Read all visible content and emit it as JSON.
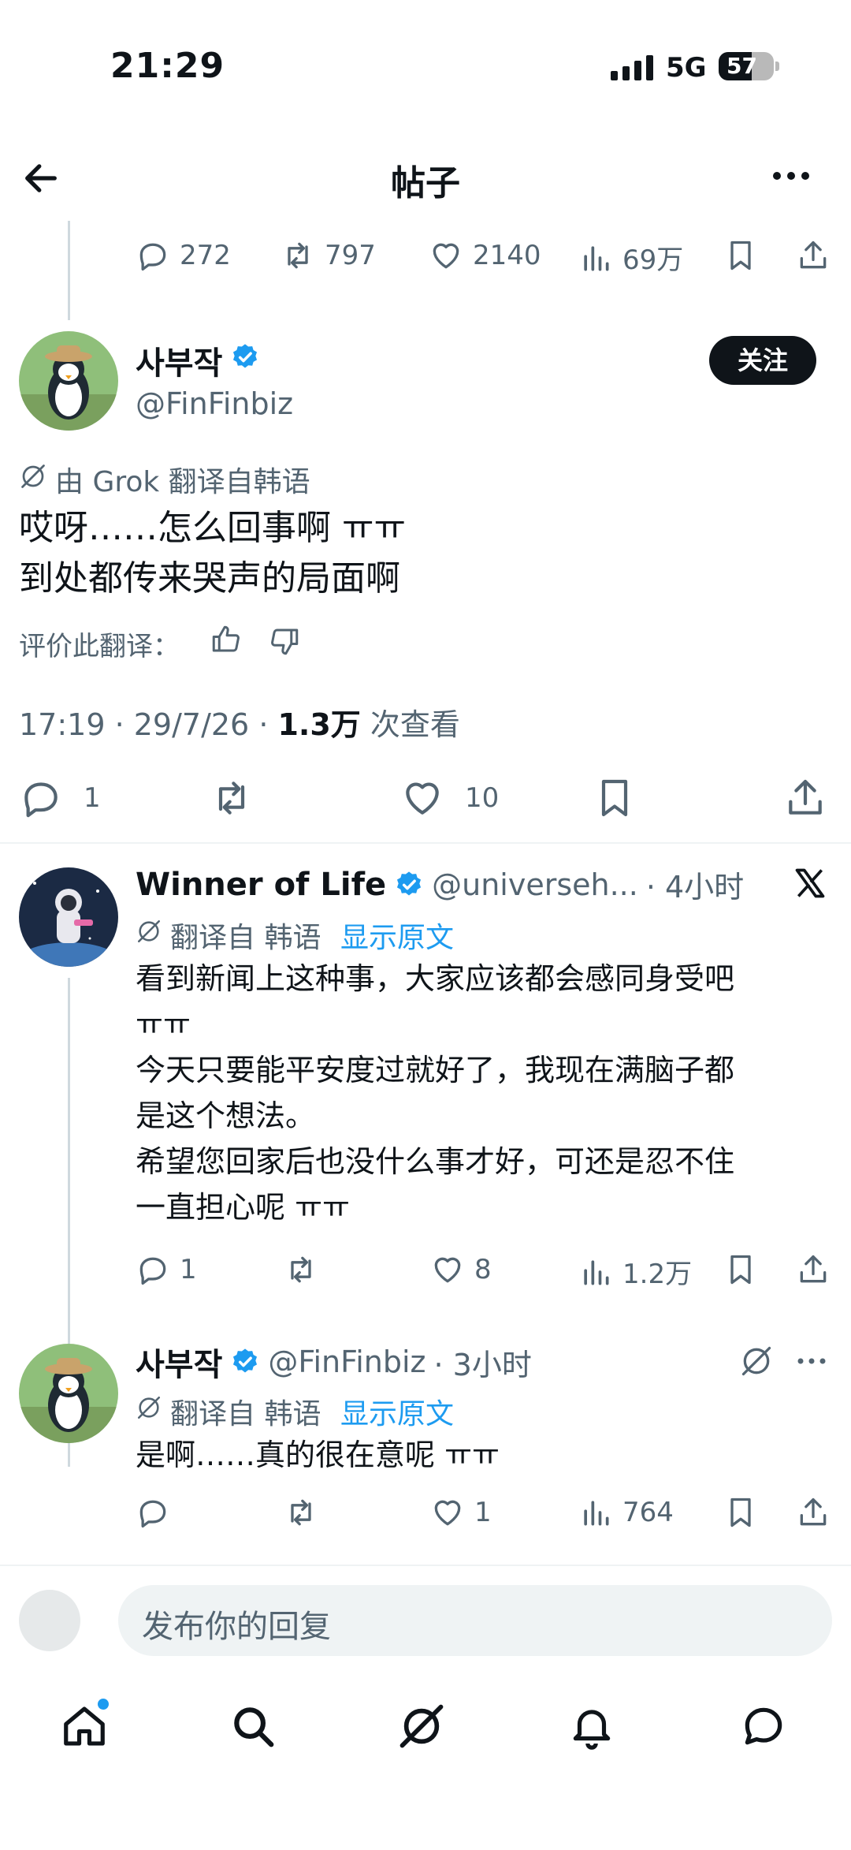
{
  "status_bar": {
    "time": "21:29",
    "network": "5G",
    "battery": "57"
  },
  "header": {
    "title": "帖子"
  },
  "top_actions": {
    "replies": "272",
    "reposts": "797",
    "likes": "2140",
    "views": "69万"
  },
  "main_post": {
    "author_name": "사부작",
    "handle": "@FinFinbiz",
    "follow_label": "关注",
    "translation_note": "由 Grok 翻译自韩语",
    "lines": [
      "哎呀……怎么回事啊 ㅠㅠ",
      "到处都传来哭声的局面啊"
    ],
    "rate_label": "评价此翻译：",
    "timestamp": "17:19 · 29/7/26 · ",
    "view_count": "1.3万",
    "view_suffix": " 次查看",
    "actions": {
      "replies": "1",
      "likes": "10"
    }
  },
  "reply1": {
    "author_name": "Winner of Life",
    "handle": "@universeh...",
    "time": "· 4小时",
    "translate_note": "翻译自 韩语",
    "show_original": "显示原文",
    "lines": [
      "看到新闻上这种事，大家应该都会感同身受吧",
      "ㅠㅠ",
      "今天只要能平安度过就好了，我现在满脑子都",
      "是这个想法。",
      "希望您回家后也没什么事才好，可还是忍不住",
      "一直担心呢 ㅠㅠ"
    ],
    "actions": {
      "replies": "1",
      "likes": "8",
      "views": "1.2万"
    }
  },
  "reply2": {
    "author_name": "사부작",
    "handle": "@FinFinbiz",
    "time": "· 3小时",
    "translate_note": "翻译自 韩语",
    "show_original": "显示原文",
    "lines": [
      "是啊……真的很在意呢 ㅠㅠ"
    ],
    "actions": {
      "likes": "1",
      "views": "764"
    }
  },
  "reply_input": {
    "placeholder": "发布你的回复"
  },
  "colors": {
    "accent": "#1d9bf0",
    "text": "#0f1419",
    "muted": "#536471"
  }
}
